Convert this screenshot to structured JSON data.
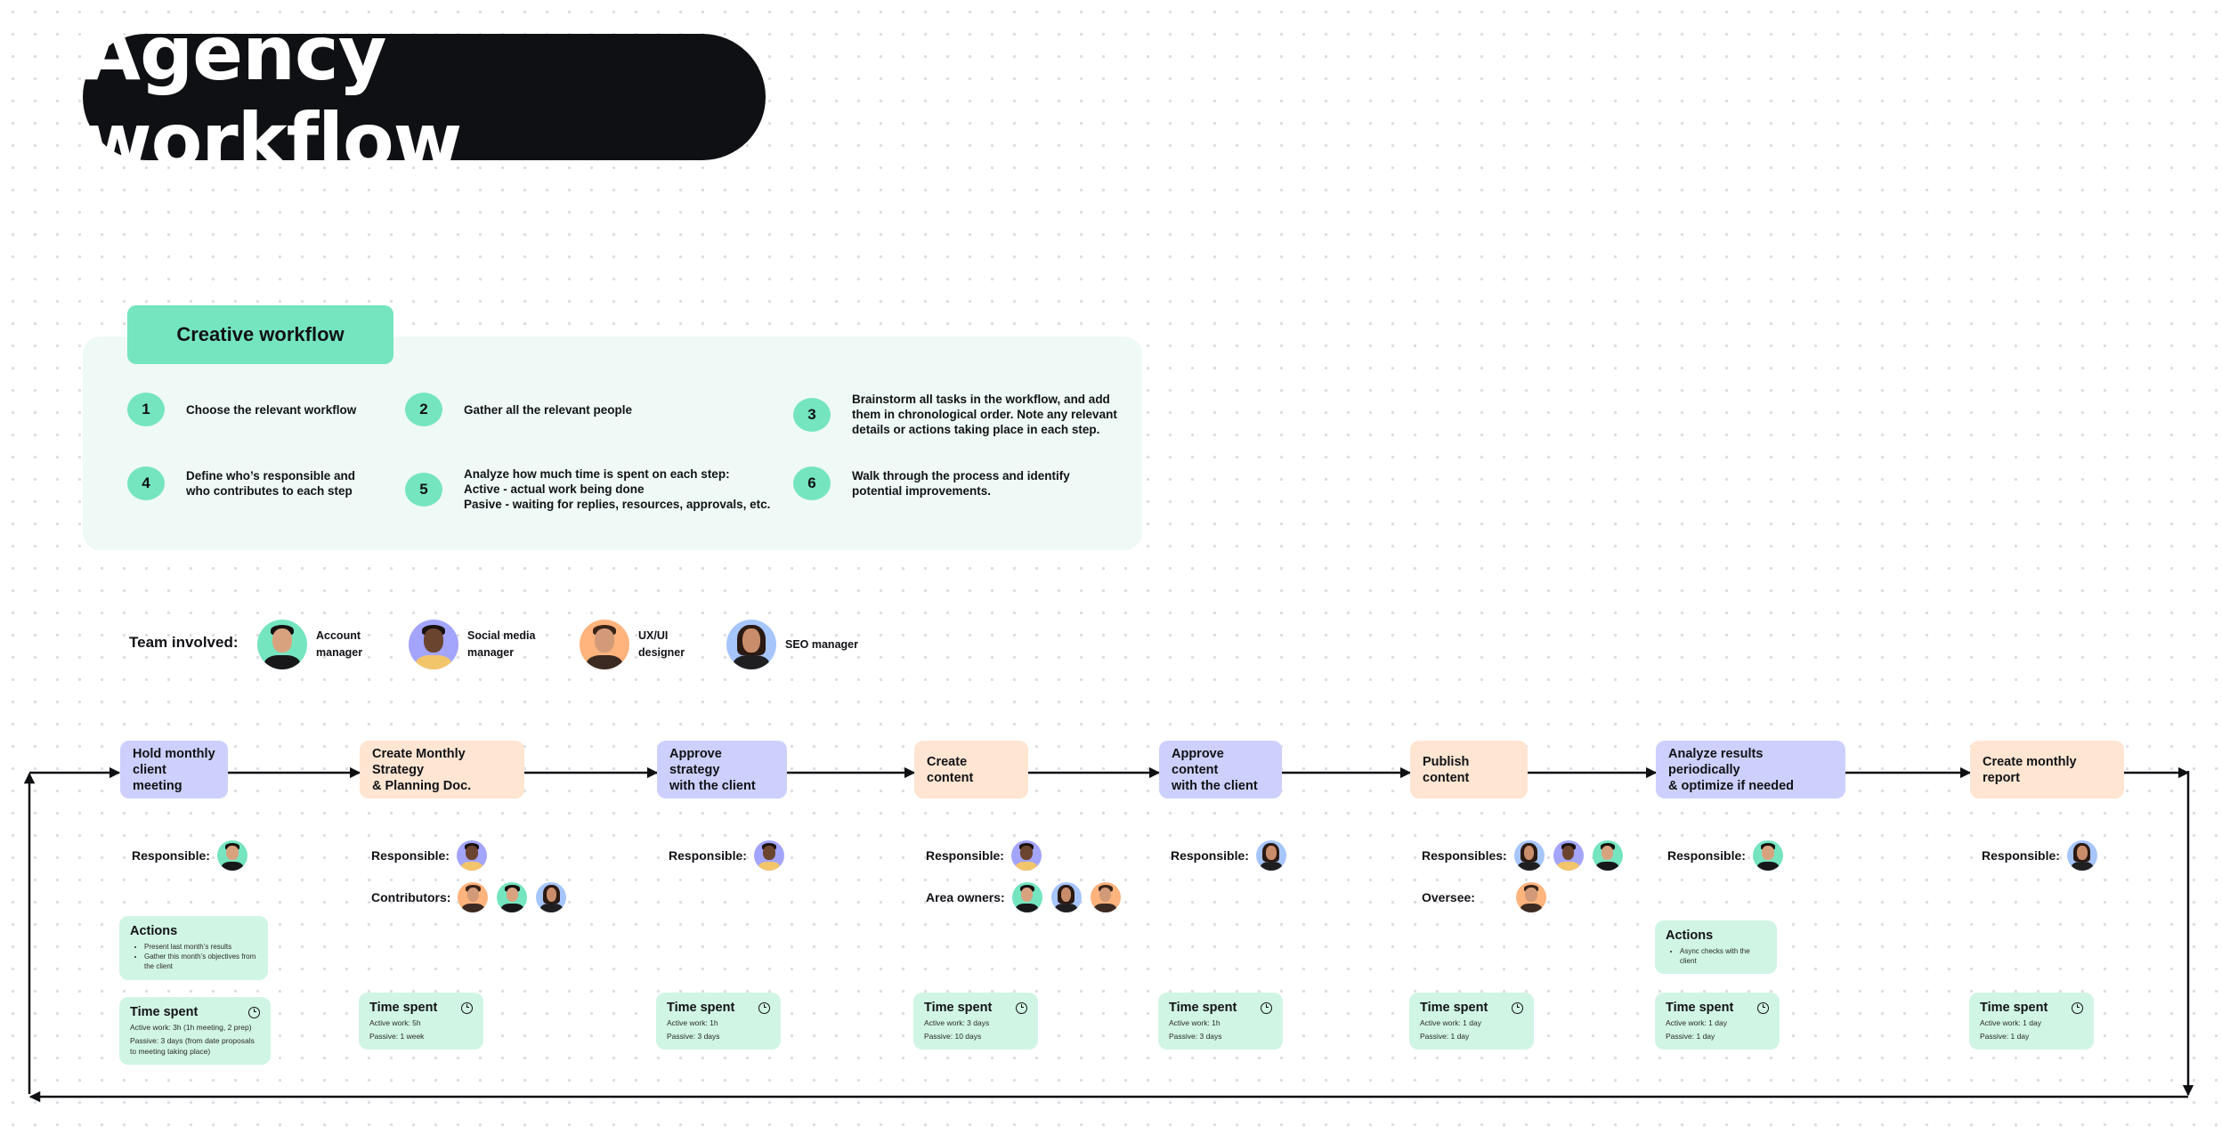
{
  "title": "Agency workflow",
  "creative_workflow": {
    "header": "Creative workflow",
    "steps": [
      {
        "num": "1",
        "text": "Choose the relevant workflow"
      },
      {
        "num": "2",
        "text": "Gather all the relevant people"
      },
      {
        "num": "3",
        "text": "Brainstorm all tasks in the workflow, and add\nthem in chronological order. Note any relevant\ndetails or actions taking place in each step."
      },
      {
        "num": "4",
        "text": "Define who’s responsible and\nwho contributes to each step"
      },
      {
        "num": "5",
        "text": "Analyze how much time is spent on each step:\nActive - actual work being done\nPasive - waiting for replies, resources, approvals, etc."
      },
      {
        "num": "6",
        "text": "Walk through the process and identify\npotential improvements."
      }
    ]
  },
  "team": {
    "label": "Team involved:",
    "members": [
      {
        "role": "Account\nmanager",
        "avatar": "account-manager",
        "color": "#74e5bf"
      },
      {
        "role": "Social media\nmanager",
        "avatar": "social-media-manager",
        "color": "#a3a4fb"
      },
      {
        "role": "UX/UI\ndesigner",
        "avatar": "ux-ui-designer",
        "color": "#ffb37d"
      },
      {
        "role": "SEO manager",
        "avatar": "seo-manager",
        "color": "#a6c5fb"
      }
    ]
  },
  "colors": {
    "purple_step": "#cdd0fc",
    "peach_step": "#ffe5d2",
    "card": "#d1f5e4",
    "accent": "#74e5bf",
    "panel": "#eff9f5",
    "title_bg": "#0f1013"
  },
  "workflow": [
    {
      "title": "Hold monthly\nclient meeting",
      "roles": [
        {
          "label": "Responsible:",
          "people": [
            "account-manager"
          ]
        }
      ],
      "actions": {
        "title": "Actions",
        "items": [
          "Present last month’s results",
          "Gather this month’s objectives from the client"
        ]
      },
      "time": {
        "title": "Time spent",
        "active": "Active work: 3h (1h meeting, 2 prep)",
        "passive": "Passive: 3 days (from date proposals to meeting taking place)"
      }
    },
    {
      "title": "Create Monthly Strategy\n& Planning Doc.",
      "roles": [
        {
          "label": "Responsible:",
          "people": [
            "social-media-manager"
          ]
        },
        {
          "label": "Contributors:",
          "people": [
            "ux-ui-designer",
            "account-manager",
            "seo-manager"
          ]
        }
      ],
      "time": {
        "title": "Time spent",
        "active": "Active work: 5h",
        "passive": "Passive: 1 week"
      }
    },
    {
      "title": "Approve strategy\nwith the client",
      "roles": [
        {
          "label": "Responsible:",
          "people": [
            "social-media-manager"
          ]
        }
      ],
      "time": {
        "title": "Time spent",
        "active": "Active work: 1h",
        "passive": "Passive: 3 days"
      }
    },
    {
      "title": "Create content",
      "roles": [
        {
          "label": "Responsible:",
          "people": [
            "social-media-manager"
          ]
        },
        {
          "label": "Area owners:",
          "people": [
            "account-manager",
            "seo-manager",
            "ux-ui-designer"
          ]
        }
      ],
      "time": {
        "title": "Time spent",
        "active": "Active work: 3 days",
        "passive": "Passive: 10 days"
      }
    },
    {
      "title": "Approve content\nwith the client",
      "roles": [
        {
          "label": "Responsible:",
          "people": [
            "seo-manager"
          ]
        }
      ],
      "time": {
        "title": "Time spent",
        "active": "Active work: 1h",
        "passive": "Passive: 3 days"
      }
    },
    {
      "title": "Publish content",
      "roles": [
        {
          "label": "Responsibles:",
          "people": [
            "seo-manager",
            "social-media-manager",
            "account-manager"
          ]
        },
        {
          "label": "Oversee:",
          "people": [
            "ux-ui-designer"
          ]
        }
      ],
      "time": {
        "title": "Time spent",
        "active": "Active work: 1 day",
        "passive": "Passive: 1 day"
      }
    },
    {
      "title": "Analyze results periodically\n& optimize if needed",
      "roles": [
        {
          "label": "Responsible:",
          "people": [
            "account-manager"
          ]
        }
      ],
      "actions": {
        "title": "Actions",
        "items": [
          "Async checks with the client"
        ]
      },
      "time": {
        "title": "Time spent",
        "active": "Active work: 1 day",
        "passive": "Passive: 1 day"
      }
    },
    {
      "title": "Create monthly report",
      "roles": [
        {
          "label": "Responsible:",
          "people": [
            "seo-manager"
          ]
        }
      ],
      "time": {
        "title": "Time spent",
        "active": "Active work: 1 day",
        "passive": "Passive: 1 day"
      }
    }
  ]
}
